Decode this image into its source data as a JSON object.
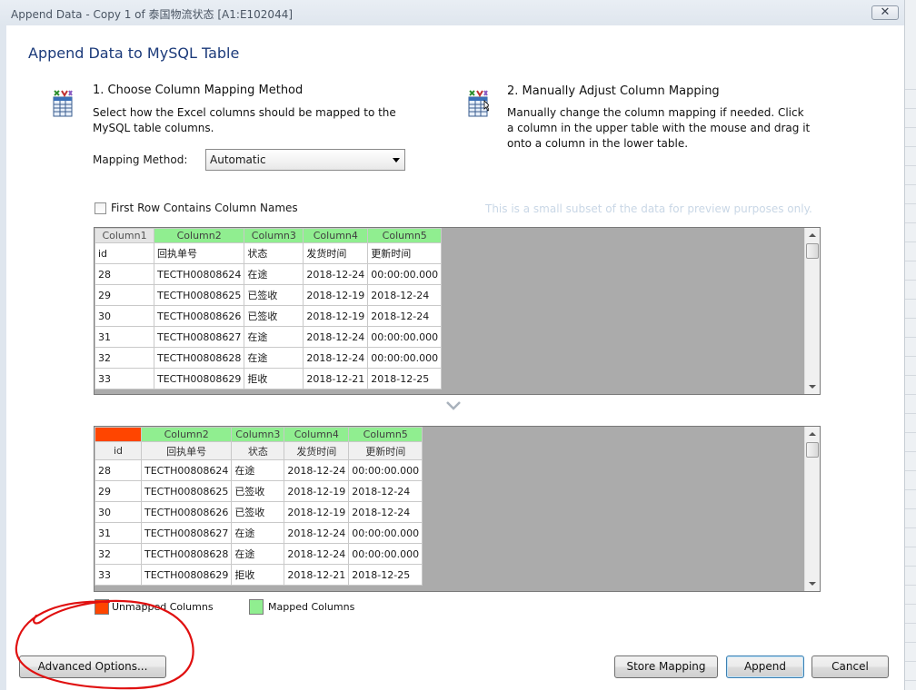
{
  "window": {
    "title": "Append Data - Copy 1 of 泰国物流状态 [A1:E102044]",
    "close_glyph": "✕"
  },
  "dialog": {
    "heading": "Append Data to MySQL Table"
  },
  "step1": {
    "icon": "table-mapping-icon",
    "heading": "1. Choose Column Mapping Method",
    "desc_line1": "Select how the Excel columns should be mapped to the",
    "desc_line2": "MySQL table columns.",
    "mapping_label": "Mapping Method:",
    "mapping_value": "Automatic"
  },
  "step2": {
    "icon": "table-mapping-icon",
    "heading": "2. Manually Adjust Column Mapping",
    "desc_line1": "Manually change the column mapping if needed. Click",
    "desc_line2": "a column in the upper table with the mouse and drag it",
    "desc_line3": "onto a column in the lower table."
  },
  "options": {
    "first_row_label": "First Row Contains Column Names",
    "first_row_checked": false,
    "preview_note": "This is a small subset of the data for preview purposes only."
  },
  "upper_table": {
    "headers": [
      "Column1",
      "Column2",
      "Column3",
      "Column4",
      "Column5"
    ],
    "rows": [
      [
        "id",
        "回执单号",
        "状态",
        "发货时间",
        "更新时间"
      ],
      [
        "28",
        "TECTH00808624",
        "在途",
        "2018-12-24",
        "00:00:00.000"
      ],
      [
        "29",
        "TECTH00808625",
        "已签收",
        "2018-12-19",
        "2018-12-24"
      ],
      [
        "30",
        "TECTH00808626",
        "已签收",
        "2018-12-19",
        "2018-12-24"
      ],
      [
        "31",
        "TECTH00808627",
        "在途",
        "2018-12-24",
        "00:00:00.000"
      ],
      [
        "32",
        "TECTH00808628",
        "在途",
        "2018-12-24",
        "00:00:00.000"
      ],
      [
        "33",
        "TECTH00808629",
        "拒收",
        "2018-12-21",
        "2018-12-25"
      ]
    ]
  },
  "lower_table": {
    "mapped_headers": [
      "",
      "Column2",
      "Column3",
      "Column4",
      "Column5"
    ],
    "column_names": [
      "id",
      "回执单号",
      "状态",
      "发货时间",
      "更新时间"
    ],
    "rows": [
      [
        "28",
        "TECTH00808624",
        "在途",
        "2018-12-24",
        "00:00:00.000"
      ],
      [
        "29",
        "TECTH00808625",
        "已签收",
        "2018-12-19",
        "2018-12-24"
      ],
      [
        "30",
        "TECTH00808626",
        "已签收",
        "2018-12-19",
        "2018-12-24"
      ],
      [
        "31",
        "TECTH00808627",
        "在途",
        "2018-12-24",
        "00:00:00.000"
      ],
      [
        "32",
        "TECTH00808628",
        "在途",
        "2018-12-24",
        "00:00:00.000"
      ],
      [
        "33",
        "TECTH00808629",
        "拒收",
        "2018-12-21",
        "2018-12-25"
      ]
    ]
  },
  "legend": {
    "unmapped_label": "Unmapped Columns",
    "mapped_label": "Mapped Columns",
    "unmapped_color": "#ff4500",
    "mapped_color": "#90ee90"
  },
  "buttons": {
    "advanced": "Advanced Options...",
    "store_mapping": "Store Mapping",
    "append": "Append",
    "cancel": "Cancel"
  },
  "annotation": {
    "color": "#e01010",
    "shape": "hand-drawn-circle"
  }
}
